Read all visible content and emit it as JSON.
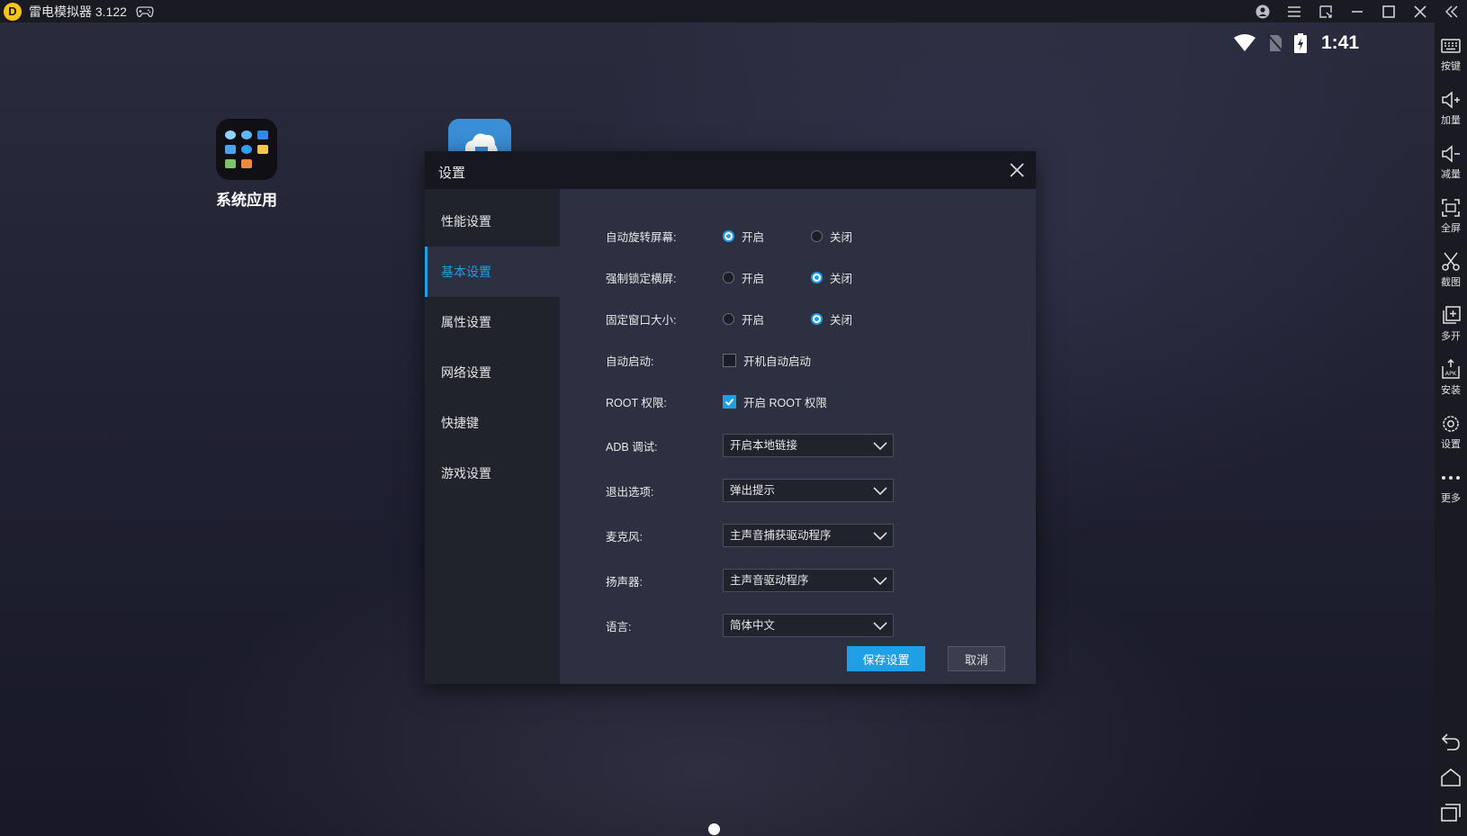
{
  "app": {
    "logo_glyph": "D",
    "title": "雷电模拟器 3.122"
  },
  "titlebar": {
    "icons": [
      "gamepad-icon",
      "account-icon",
      "menu-icon",
      "restore-window-icon",
      "minimize-icon",
      "maximize-icon",
      "close-icon",
      "collapse-icon"
    ]
  },
  "statusbar": {
    "time": "1:41",
    "icons": [
      "wifi-icon",
      "no-sim-icon",
      "battery-charging-icon"
    ]
  },
  "desktop": {
    "apps": [
      {
        "label": "系统应用",
        "icon": "system-apps-folder-icon"
      },
      {
        "label": "",
        "icon": "cloud-app-icon"
      }
    ],
    "page_indicator": {
      "count": 1,
      "active": 0
    }
  },
  "right_toolbar": {
    "items": [
      {
        "label": "按键",
        "icon": "keyboard-icon"
      },
      {
        "label": "加量",
        "icon": "volume-up-icon"
      },
      {
        "label": "减量",
        "icon": "volume-down-icon"
      },
      {
        "label": "全屏",
        "icon": "fullscreen-icon"
      },
      {
        "label": "截图",
        "icon": "scissors-icon"
      },
      {
        "label": "多开",
        "icon": "multi-instance-icon"
      },
      {
        "label": "安装",
        "icon": "apk-install-icon"
      },
      {
        "label": "设置",
        "icon": "gear-icon"
      },
      {
        "label": "更多",
        "icon": "more-icon"
      }
    ],
    "nav": [
      "back-icon",
      "home-icon",
      "recents-icon"
    ]
  },
  "settings_dialog": {
    "title": "设置",
    "nav": [
      {
        "label": "性能设置",
        "active": false
      },
      {
        "label": "基本设置",
        "active": true
      },
      {
        "label": "属性设置",
        "active": false
      },
      {
        "label": "网络设置",
        "active": false
      },
      {
        "label": "快捷键",
        "active": false
      },
      {
        "label": "游戏设置",
        "active": false
      }
    ],
    "radio_rows": [
      {
        "label": "自动旋转屏幕:",
        "on_label": "开启",
        "off_label": "关闭",
        "selected": "on"
      },
      {
        "label": "强制锁定横屏:",
        "on_label": "开启",
        "off_label": "关闭",
        "selected": "off"
      },
      {
        "label": "固定窗口大小:",
        "on_label": "开启",
        "off_label": "关闭",
        "selected": "off"
      }
    ],
    "checkbox_rows": [
      {
        "label": "自动启动:",
        "option": "开机自动启动",
        "checked": false
      },
      {
        "label": "ROOT 权限:",
        "option": "开启 ROOT 权限",
        "checked": true
      }
    ],
    "select_rows": [
      {
        "label": "ADB 调试:",
        "value": "开启本地链接"
      },
      {
        "label": "退出选项:",
        "value": "弹出提示"
      },
      {
        "label": "麦克风:",
        "value": "主声音捕获驱动程序"
      },
      {
        "label": "扬声器:",
        "value": "主声音驱动程序"
      },
      {
        "label": "语言:",
        "value": "简体中文"
      }
    ],
    "save_label": "保存设置",
    "cancel_label": "取消"
  },
  "colors": {
    "accent": "#1e9fe6",
    "titlebar": "#191a22",
    "dialog_body": "#2d3040",
    "dialog_nav": "#20222c"
  }
}
